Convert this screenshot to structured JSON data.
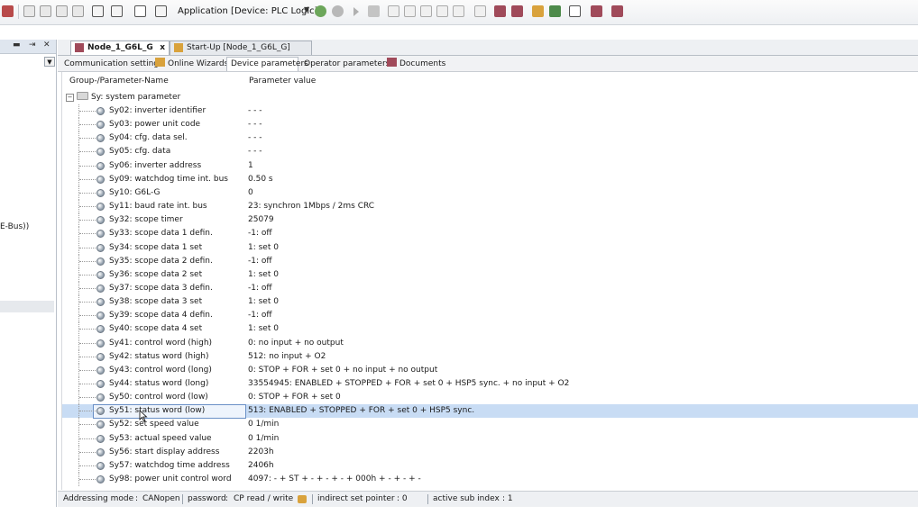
{
  "toolbar": {
    "application_label": "Application [Device: PLC Logic]",
    "icons": [
      "save-icon",
      "undo-icon",
      "redo-icon",
      "cut-icon",
      "copy-icon",
      "paste-icon",
      "delete-icon",
      "find-icon",
      "application-icon",
      "login-icon",
      "logout-icon",
      "start-icon",
      "stop-icon",
      "breakpoint-icon",
      "step-over-icon",
      "step-into-icon",
      "step-out-icon",
      "reset-icon",
      "cycle-icon",
      "watch-icon",
      "device-icon",
      "wizard-icon",
      "documents-icon",
      "scope-icon",
      "network-icon",
      "config-icon"
    ]
  },
  "left_panel": {
    "pin_label": "⇥",
    "close_label": "✕",
    "dropdown_label": "▼",
    "item_text": "E-Bus))"
  },
  "editor_tabs": [
    {
      "label": "Node_1_G6L_G",
      "close": "x",
      "active": true
    },
    {
      "label": "Start-Up [Node_1_G6L_G]",
      "active": false
    }
  ],
  "sub_tabs": [
    {
      "label": "Communication settings",
      "active": false
    },
    {
      "label": "Online Wizards",
      "active": false
    },
    {
      "label": "Device parameters",
      "active": true
    },
    {
      "label": "Operator parameters",
      "active": false
    },
    {
      "label": "Documents",
      "active": false
    }
  ],
  "grid": {
    "col_name": "Group-/Parameter-Name",
    "col_value": "Parameter value",
    "group_label": "Sy: system parameter",
    "expander": "−",
    "rows": [
      {
        "name": "Sy02: inverter identifier",
        "value": "- - -"
      },
      {
        "name": "Sy03: power unit code",
        "value": "- - -"
      },
      {
        "name": "Sy04: cfg. data sel.",
        "value": "- - -"
      },
      {
        "name": "Sy05: cfg. data",
        "value": "- - -"
      },
      {
        "name": "Sy06: inverter address",
        "value": "1"
      },
      {
        "name": "Sy09: watchdog time int. bus",
        "value": "0.50 s"
      },
      {
        "name": "Sy10: G6L-G",
        "value": "0"
      },
      {
        "name": "Sy11: baud rate int. bus",
        "value": "23: synchron 1Mbps / 2ms CRC"
      },
      {
        "name": "Sy32: scope timer",
        "value": "25079"
      },
      {
        "name": "Sy33: scope data 1 defin.",
        "value": "-1: off"
      },
      {
        "name": "Sy34: scope data 1 set",
        "value": "1: set 0"
      },
      {
        "name": "Sy35: scope data 2 defin.",
        "value": "-1: off"
      },
      {
        "name": "Sy36: scope data 2 set",
        "value": "1: set 0"
      },
      {
        "name": "Sy37: scope data 3 defin.",
        "value": "-1: off"
      },
      {
        "name": "Sy38: scope data 3 set",
        "value": "1: set 0"
      },
      {
        "name": "Sy39: scope data 4 defin.",
        "value": "-1: off"
      },
      {
        "name": "Sy40: scope data 4 set",
        "value": "1: set 0"
      },
      {
        "name": "Sy41: control word (high)",
        "value": "0: no input + no output"
      },
      {
        "name": "Sy42: status word (high)",
        "value": "512: no input + O2"
      },
      {
        "name": "Sy43: control word (long)",
        "value": "0: STOP + FOR + set 0 + no input + no output"
      },
      {
        "name": "Sy44: status word (long)",
        "value": "33554945: ENABLED + STOPPED + FOR + set 0 + HSP5 sync. + no input + O2"
      },
      {
        "name": "Sy50: control word (low)",
        "value": "0: STOP + FOR + set 0"
      },
      {
        "name": "Sy51: status word (low)",
        "value": "513: ENABLED + STOPPED + FOR + set 0 + HSP5 sync.",
        "selected": true
      },
      {
        "name": "Sy52: set speed value",
        "value": "0 1/min"
      },
      {
        "name": "Sy53: actual speed value",
        "value": "0 1/min"
      },
      {
        "name": "Sy56: start display address",
        "value": "2203h"
      },
      {
        "name": "Sy57: watchdog time address",
        "value": "2406h"
      },
      {
        "name": "Sy98: power unit control word",
        "value": "4097: - + ST + - + - + - + 000h + - + - + -"
      }
    ]
  },
  "status_bar": {
    "addressing_mode": "Addressing mode",
    "protocol": "CANopen",
    "password": "password",
    "password_mode": "CP read / write",
    "indirect_set_pointer": "indirect set pointer",
    "pointer_value": ": 0",
    "active_sub_index": "active sub index",
    "sub_index_value": ": 1"
  },
  "colors": {
    "selection": "#c8dcf4",
    "selection_border": "#6a90c6"
  }
}
